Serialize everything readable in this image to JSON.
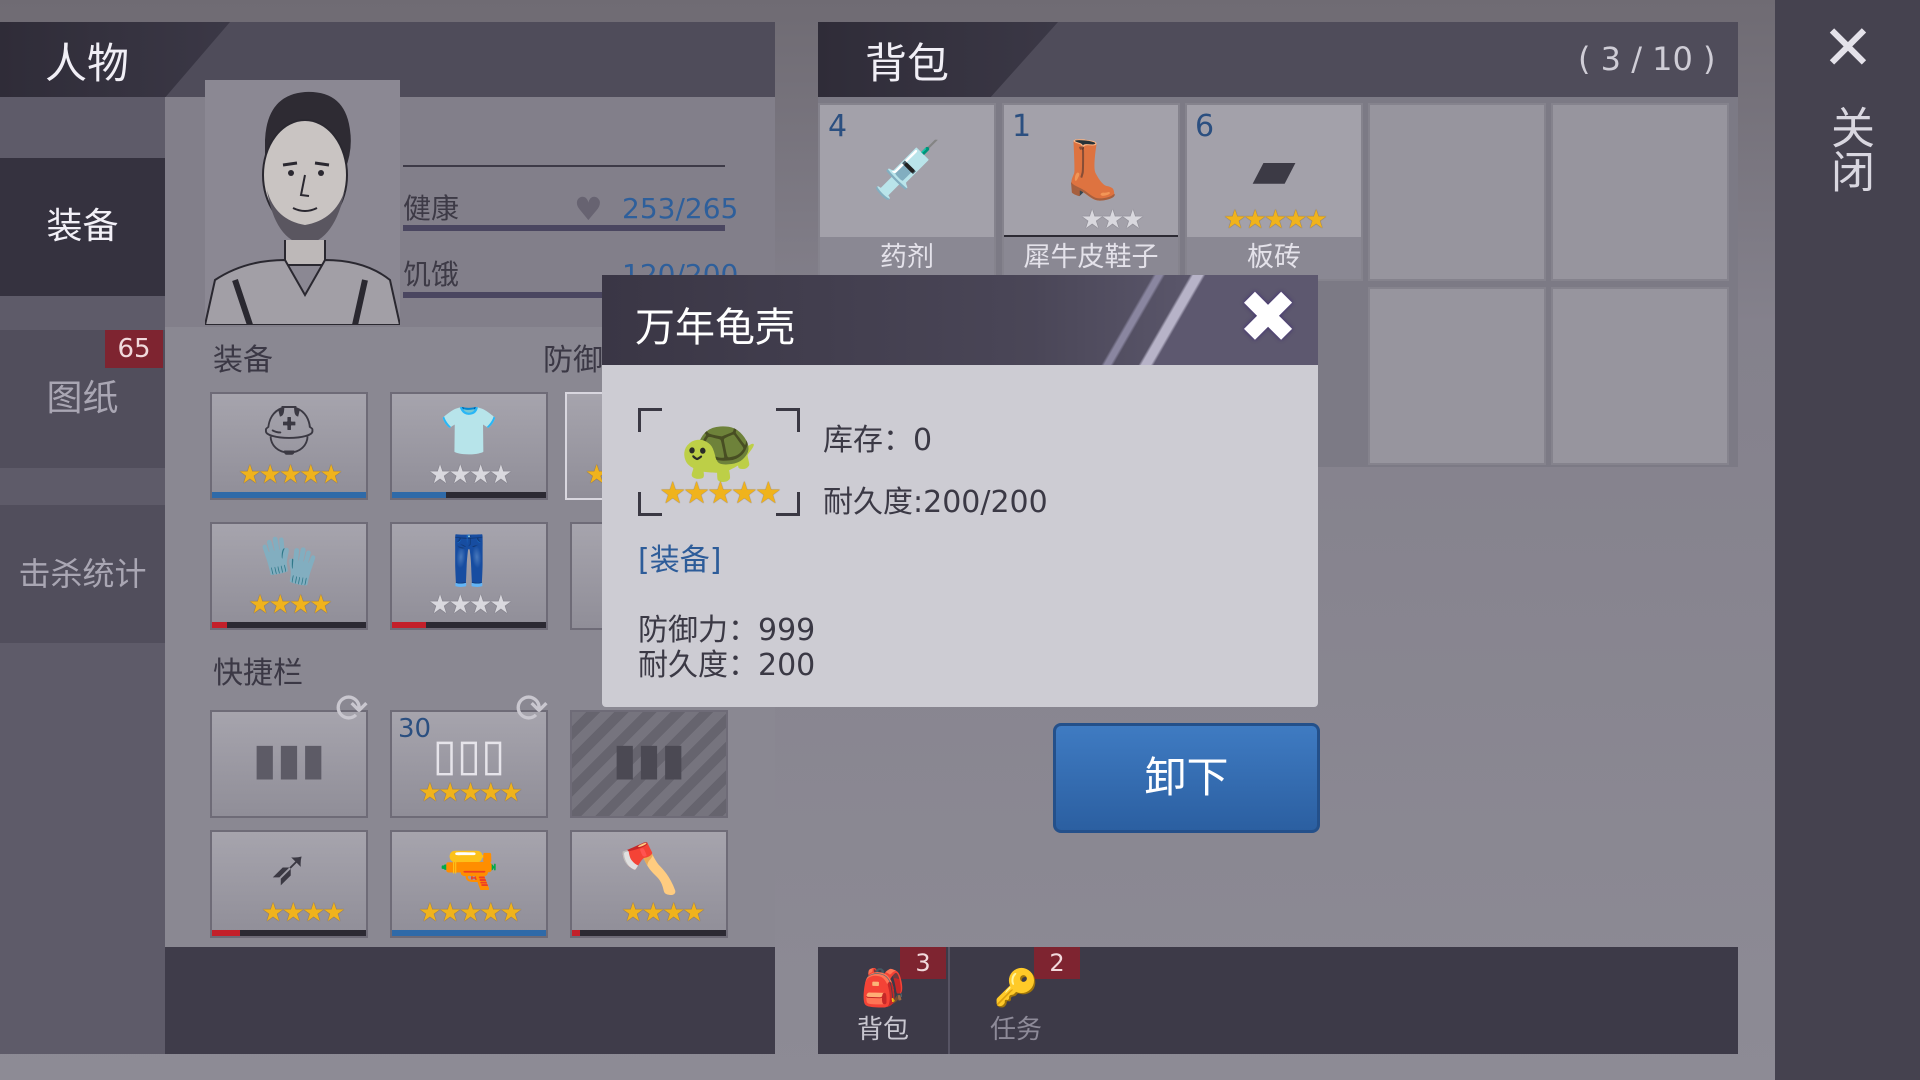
{
  "close_rail": {
    "icon": "close-icon",
    "symbol": "✕",
    "label": "关闭"
  },
  "character_panel": {
    "title": "人物",
    "nav": [
      {
        "label": "装备",
        "active": true
      },
      {
        "label": "图纸",
        "badge": "65"
      },
      {
        "label": "击杀统计"
      }
    ],
    "stats": [
      {
        "label": "健康",
        "value": "253/265",
        "icon": "heart-icon"
      },
      {
        "label": "饥饿",
        "value": "120/200",
        "icon": "hunger-icon"
      }
    ],
    "equipment_title": "装备",
    "defense_label": "防御",
    "equipment_slots": [
      {
        "icon": "helmet-icon",
        "symbol": "⛑",
        "stars": 5,
        "durability": 1.0,
        "bar_color": "#2f6aa8"
      },
      {
        "icon": "jacket-icon",
        "symbol": "👕",
        "stars_gold": 0,
        "stars_total": 4,
        "durability": 0.35,
        "bar_color": "#2f6aa8"
      },
      {
        "icon": "gloves-icon",
        "symbol": "🧤",
        "stars": 4,
        "durability": 0.1,
        "bar_color": "#c3202a"
      },
      {
        "icon": "pants-icon",
        "symbol": "👖",
        "stars_gold": 0,
        "stars_total": 4,
        "durability": 0.22,
        "bar_color": "#c3202a"
      }
    ],
    "hotbar_title": "快捷栏",
    "hotbar_slots": [
      {
        "icon": "ammo-icon",
        "symbol": "▮▮▮",
        "count": ""
      },
      {
        "icon": "ammo-icon",
        "symbol": "▯▯▯",
        "count": "30",
        "stars": 5
      },
      {
        "icon": "ammo-icon",
        "symbol": "▮▮▮",
        "locked": true
      },
      {
        "icon": "crossbow-icon",
        "symbol": "➶",
        "stars": 4,
        "durability": 0.18,
        "bar_color": "#c3202a"
      },
      {
        "icon": "revolver-icon",
        "symbol": "🔫",
        "stars": 5,
        "durability": 1.0,
        "bar_color": "#2f6aa8"
      },
      {
        "icon": "axe-icon",
        "symbol": "🪓",
        "stars": 4,
        "durability": 0.05,
        "bar_color": "#c3202a"
      }
    ]
  },
  "backpack": {
    "title": "背包",
    "capacity": "( 3 / 10 )",
    "items": [
      {
        "count": "4",
        "name": "药剂",
        "icon": "syringe-icon",
        "symbol": "💉",
        "stars": 0
      },
      {
        "count": "1",
        "name": "犀牛皮鞋子",
        "icon": "boots-icon",
        "symbol": "👢",
        "stars_gold": 0,
        "stars_total": 3
      },
      {
        "count": "6",
        "name": "板砖",
        "icon": "brick-icon",
        "symbol": "▰",
        "stars": 5
      }
    ],
    "unequip_label": "卸下",
    "bottom_tabs": [
      {
        "label": "背包",
        "badge": "3",
        "icon": "backpack-icon",
        "symbol": "🎒"
      },
      {
        "label": "任务",
        "badge": "2",
        "icon": "key-icon",
        "symbol": "🔑"
      }
    ]
  },
  "dialog": {
    "title": "万年龟壳",
    "close_symbol": "✖",
    "item_icon": "turtle-shell-icon",
    "item_symbol": "🐢",
    "stars": 5,
    "stock": "库存：0",
    "durability": "耐久度:200/200",
    "type_link": "[装备]",
    "defense": "防御力：999",
    "durability_stat": "耐久度：200"
  }
}
